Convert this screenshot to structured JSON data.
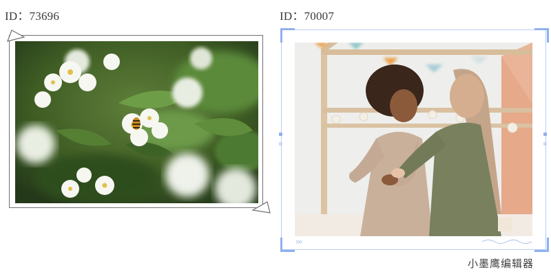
{
  "left_card": {
    "id_label": "ID：73696",
    "photo_icon": "white-flowers-with-bee-photo"
  },
  "right_card": {
    "id_label": "ID：70007",
    "photo_icon": "two-girls-dancing-photo",
    "chevrons": "›››"
  },
  "watermark": "小墨鹰编辑器",
  "colors": {
    "selection": "#8fb0ee",
    "frame_border": "#6f6f6f"
  }
}
